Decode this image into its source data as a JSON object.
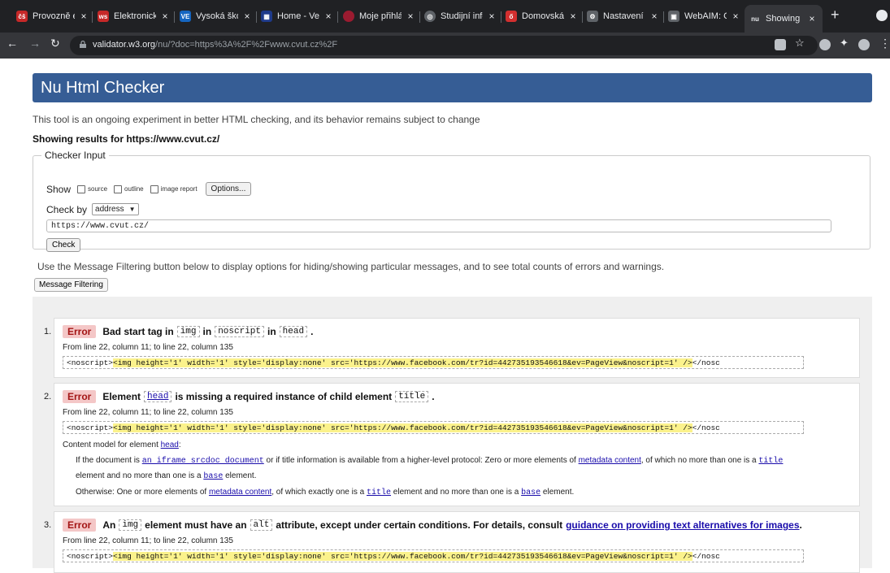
{
  "browser": {
    "tabs": [
      {
        "label": "Provozně e",
        "fav_color": "#c62828",
        "fav_text": "čš"
      },
      {
        "label": "Elektronick",
        "fav_color": "#c62828",
        "fav_text": "ws"
      },
      {
        "label": "Vysoká ško",
        "fav_color": "#1565c0",
        "fav_text": "VE"
      },
      {
        "label": "Home - Vel",
        "fav_color": "#1e3a8a",
        "fav_text": "▦"
      },
      {
        "label": "Moje přihlá",
        "fav_color": "#9b1b30",
        "fav_text": ""
      },
      {
        "label": "Studijní info",
        "fav_color": "#5f6368",
        "fav_text": "◎"
      },
      {
        "label": "Domovská",
        "fav_color": "#d32f2f",
        "fav_text": "ő"
      },
      {
        "label": "Nastavení",
        "fav_color": "#5f6368",
        "fav_text": "⚙"
      },
      {
        "label": "WebAIM: C",
        "fav_color": "#5f6368",
        "fav_text": "▣"
      },
      {
        "label": "Showing re",
        "fav_color": "#35363a",
        "fav_text": "nu"
      }
    ],
    "close_glyph": "×",
    "new_tab_glyph": "+",
    "url_host": "validator.w3.org",
    "url_rest": "/nu/?doc=https%3A%2F%2Fwww.cvut.cz%2F"
  },
  "page": {
    "title": "Nu Html Checker",
    "intro": "This tool is an ongoing experiment in better HTML checking, and its behavior remains subject to change",
    "showing": "Showing results for https://www.cvut.cz/",
    "checker_input": {
      "legend": "Checker Input",
      "show_label": "Show",
      "opt_source": "source",
      "opt_outline": "outline",
      "opt_image_report": "image report",
      "options_button": "Options...",
      "check_by_label": "Check by",
      "check_by_value": "address",
      "url_value": "https://www.cvut.cz/",
      "check_button": "Check"
    },
    "filter_intro": "Use the Message Filtering button below to display options for hiding/showing particular messages, and to see total counts of errors and warnings.",
    "message_filtering_button": "Message Filtering"
  },
  "messages": [
    {
      "num": "1.",
      "type": "Error",
      "t1": "Bad start tag in",
      "c1": "img",
      "t2": "in",
      "c2": "noscript",
      "t3": "in",
      "c3": "head",
      "t4": ".",
      "location": "From line 22, column 11; to line 22, column 135",
      "snippet_pre": "<noscript>",
      "snippet_hl": "<img height='1' width='1' style='display:none' src='https://www.facebook.com/tr?id=442735193546618&ev=PageView&noscript=1' />",
      "snippet_post": "</nosc"
    },
    {
      "num": "2.",
      "type": "Error",
      "t1": "Element",
      "c1": "head",
      "t2": "is missing a required instance of child element",
      "c2": "title",
      "t3": ".",
      "location": "From line 22, column 11; to line 22, column 135",
      "snippet_pre": "<noscript>",
      "snippet_hl": "<img height='1' width='1' style='display:none' src='https://www.facebook.com/tr?id=442735193546618&ev=PageView&noscript=1' />",
      "snippet_post": "</nosc",
      "content_model_label": "Content model for element",
      "content_model_link": "head",
      "content_model_colon": ":",
      "cm1_a": "If the document is",
      "cm1_link": "an iframe srcdoc document",
      "cm1_b": "or if title information is available from a higher-level protocol: Zero or more elements of",
      "cm1_link2": "metadata content",
      "cm1_c": ", of which no more than one is a",
      "cm1_title": "title",
      "cm1_d": "element and no more than one is a",
      "cm1_base": "base",
      "cm1_e": "element.",
      "cm2_a": "Otherwise: One or more elements of",
      "cm2_link": "metadata content",
      "cm2_b": ", of which exactly one is a",
      "cm2_title": "title",
      "cm2_c": "element and no more than one is a",
      "cm2_base": "base",
      "cm2_d": "element."
    },
    {
      "num": "3.",
      "type": "Error",
      "t1": "An",
      "c1": "img",
      "t2": "element must have an",
      "c2": "alt",
      "t3": "attribute, except under certain conditions. For details, consult",
      "link": "guidance on providing text alternatives for images",
      "t4": ".",
      "location": "From line 22, column 11; to line 22, column 135",
      "snippet_pre": "<noscript>",
      "snippet_hl": "<img height='1' width='1' style='display:none' src='https://www.facebook.com/tr?id=442735193546618&ev=PageView&noscript=1' />",
      "snippet_post": "</nosc"
    }
  ]
}
